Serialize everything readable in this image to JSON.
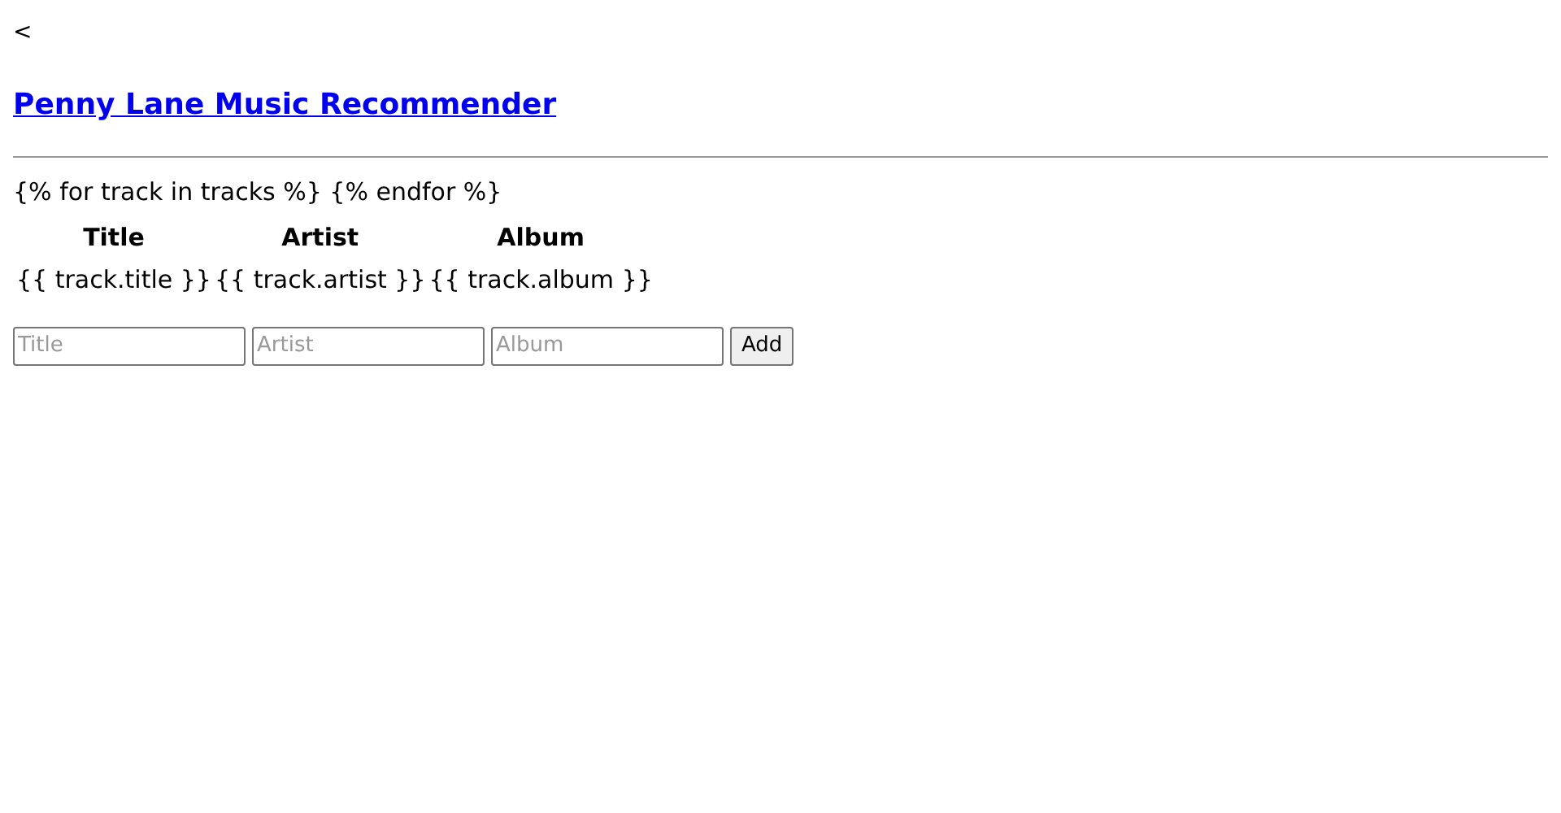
{
  "back_link": "<",
  "title_link": "Penny Lane Music Recommender",
  "template_loop": "{% for track in tracks %} {% endfor %}",
  "table": {
    "columns": [
      "Title",
      "Artist",
      "Album"
    ],
    "rows": [
      [
        "{{ track.title }}",
        "{{ track.artist }}",
        "{{ track.album }}"
      ]
    ]
  },
  "form": {
    "fields": [
      {
        "placeholder": "Title"
      },
      {
        "placeholder": "Artist"
      },
      {
        "placeholder": "Album"
      }
    ],
    "button": "Add"
  }
}
